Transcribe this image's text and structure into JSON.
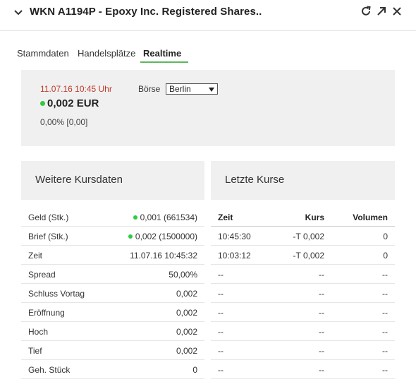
{
  "header": {
    "title": "WKN A1194P - Epoxy Inc. Registered Shares..",
    "icons": [
      "chevron-down-icon",
      "refresh-icon",
      "open-external-icon",
      "close-icon"
    ]
  },
  "tabs": [
    {
      "label": "Stammdaten",
      "active": false
    },
    {
      "label": "Handelsplätze",
      "active": false
    },
    {
      "label": "Realtime",
      "active": true
    }
  ],
  "quote": {
    "datetime": "11.07.16  10:45 Uhr",
    "price": "0,002 EUR",
    "change": "0,00%  [0,00]",
    "boerse_label": "Börse",
    "boerse_selected": "Berlin"
  },
  "weitere": {
    "title": "Weitere Kursdaten",
    "rows": [
      {
        "label": "Geld (Stk.)",
        "value": "0,001 (661534)",
        "dot": true
      },
      {
        "label": "Brief (Stk.)",
        "value": "0,002 (1500000)",
        "dot": true
      },
      {
        "label": "Zeit",
        "value": "11.07.16 10:45:32",
        "dot": false
      },
      {
        "label": "Spread",
        "value": "50,00%",
        "dot": false
      },
      {
        "label": "Schluss Vortag",
        "value": "0,002",
        "dot": false
      },
      {
        "label": "Eröffnung",
        "value": "0,002",
        "dot": false
      },
      {
        "label": "Hoch",
        "value": "0,002",
        "dot": false
      },
      {
        "label": "Tief",
        "value": "0,002",
        "dot": false
      },
      {
        "label": "Geh. Stück",
        "value": "0",
        "dot": false
      }
    ]
  },
  "letzte": {
    "title": "Letzte Kurse",
    "columns": [
      "Zeit",
      "Kurs",
      "Volumen"
    ],
    "rows": [
      [
        "10:45:30",
        "-T 0,002",
        "0"
      ],
      [
        "10:03:12",
        "-T 0,002",
        "0"
      ],
      [
        "--",
        "--",
        "--"
      ],
      [
        "--",
        "--",
        "--"
      ],
      [
        "--",
        "--",
        "--"
      ],
      [
        "--",
        "--",
        "--"
      ],
      [
        "--",
        "--",
        "--"
      ],
      [
        "--",
        "--",
        "--"
      ]
    ]
  },
  "colors": {
    "accent_green": "#5cb85c",
    "dot_green": "#2ecc40",
    "datetime_red": "#c0392b",
    "panel_bg": "#f0f0f0"
  }
}
